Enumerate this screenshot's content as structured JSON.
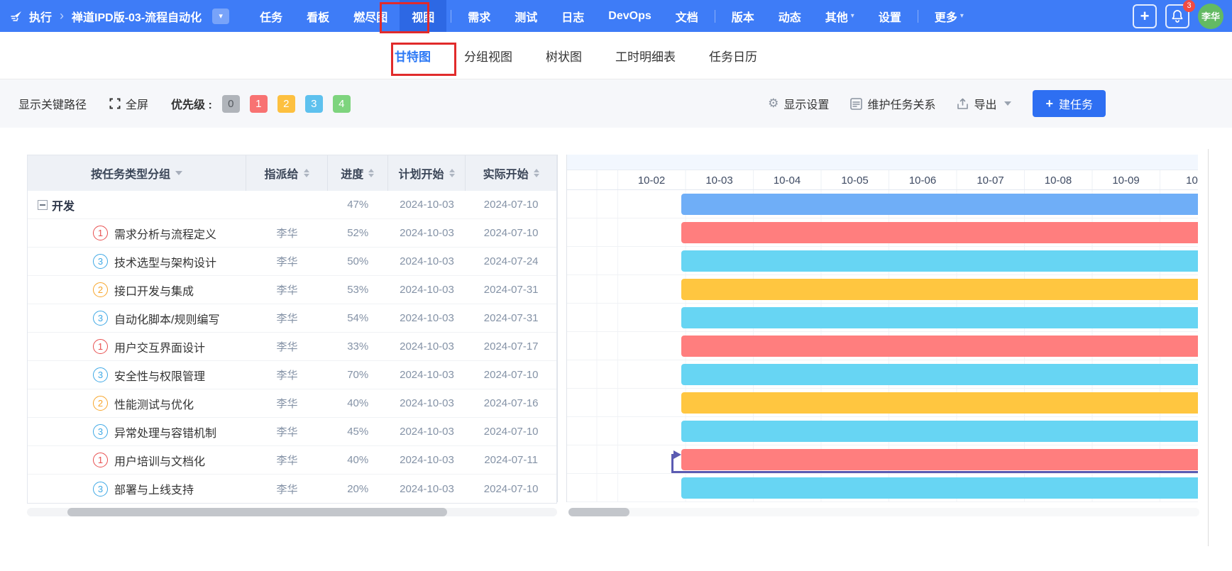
{
  "navbar": {
    "breadcrumb": {
      "section": "执行",
      "project": "禅道IPD版-03-流程自动化"
    },
    "items": [
      {
        "label": "任务"
      },
      {
        "label": "看板"
      },
      {
        "label": "燃尽图"
      },
      {
        "label": "视图",
        "active": true,
        "divider_after": true
      },
      {
        "label": "需求"
      },
      {
        "label": "测试"
      },
      {
        "label": "日志"
      },
      {
        "label": "DevOps"
      },
      {
        "label": "文档",
        "divider_after": true
      },
      {
        "label": "版本"
      },
      {
        "label": "动态"
      },
      {
        "label": "其他",
        "caret": true
      },
      {
        "label": "设置",
        "divider_after": true
      },
      {
        "label": "更多",
        "caret": true
      }
    ],
    "notification_count": "3",
    "avatar": "李华"
  },
  "tabs": [
    {
      "label": "甘特图",
      "active": true
    },
    {
      "label": "分组视图"
    },
    {
      "label": "树状图"
    },
    {
      "label": "工时明细表"
    },
    {
      "label": "任务日历"
    }
  ],
  "toolbar": {
    "show_critical_path": "显示关键路径",
    "fullscreen": "全屏",
    "priority_label": "优先级 :",
    "priorities": [
      {
        "label": "0",
        "bg": "#b0b4ba",
        "color": "#565a60"
      },
      {
        "label": "1",
        "bg": "#f87272",
        "color": "#ffffff"
      },
      {
        "label": "2",
        "bg": "#fdc040",
        "color": "#ffffff"
      },
      {
        "label": "3",
        "bg": "#5ec1ee",
        "color": "#ffffff"
      },
      {
        "label": "4",
        "bg": "#7ed47e",
        "color": "#ffffff"
      }
    ],
    "display_settings": "显示设置",
    "maintain_relations": "维护任务关系",
    "export": "导出",
    "create_task": "建任务"
  },
  "table": {
    "headers": {
      "group_by": "按任务类型分组",
      "assignee": "指派给",
      "progress": "进度",
      "planned_start": "计划开始",
      "actual_start": "实际开始"
    },
    "rows": [
      {
        "group": true,
        "name": "开发",
        "assignee": "",
        "progress": "47%",
        "planned_start": "2024-10-03",
        "actual_start": "2024-07-10",
        "bar_color": "#6faef7"
      },
      {
        "priority": "1",
        "priority_color": "#e84f4f",
        "name": "需求分析与流程定义",
        "assignee": "李华",
        "progress": "52%",
        "planned_start": "2024-10-03",
        "actual_start": "2024-07-10",
        "bar_color": "#ff7e7e"
      },
      {
        "priority": "3",
        "priority_color": "#3ea8e5",
        "name": "技术选型与架构设计",
        "assignee": "李华",
        "progress": "50%",
        "planned_start": "2024-10-03",
        "actual_start": "2024-07-24",
        "bar_color": "#67d5f3"
      },
      {
        "priority": "2",
        "priority_color": "#f7a52b",
        "name": "接口开发与集成",
        "assignee": "李华",
        "progress": "53%",
        "planned_start": "2024-10-03",
        "actual_start": "2024-07-31",
        "bar_color": "#ffc640"
      },
      {
        "priority": "3",
        "priority_color": "#3ea8e5",
        "name": "自动化脚本/规则编写",
        "assignee": "李华",
        "progress": "54%",
        "planned_start": "2024-10-03",
        "actual_start": "2024-07-31",
        "bar_color": "#67d5f3"
      },
      {
        "priority": "1",
        "priority_color": "#e84f4f",
        "name": "用户交互界面设计",
        "assignee": "李华",
        "progress": "33%",
        "planned_start": "2024-10-03",
        "actual_start": "2024-07-17",
        "bar_color": "#ff7e7e"
      },
      {
        "priority": "3",
        "priority_color": "#3ea8e5",
        "name": "安全性与权限管理",
        "assignee": "李华",
        "progress": "70%",
        "planned_start": "2024-10-03",
        "actual_start": "2024-07-10",
        "bar_color": "#67d5f3"
      },
      {
        "priority": "2",
        "priority_color": "#f7a52b",
        "name": "性能测试与优化",
        "assignee": "李华",
        "progress": "40%",
        "planned_start": "2024-10-03",
        "actual_start": "2024-07-16",
        "bar_color": "#ffc640"
      },
      {
        "priority": "3",
        "priority_color": "#3ea8e5",
        "name": "异常处理与容错机制",
        "assignee": "李华",
        "progress": "45%",
        "planned_start": "2024-10-03",
        "actual_start": "2024-07-10",
        "bar_color": "#67d5f3"
      },
      {
        "priority": "1",
        "priority_color": "#e84f4f",
        "name": "用户培训与文档化",
        "assignee": "李华",
        "progress": "40%",
        "planned_start": "2024-10-03",
        "actual_start": "2024-07-11",
        "bar_color": "#ff7e7e",
        "dependency": true
      },
      {
        "priority": "3",
        "priority_color": "#3ea8e5",
        "name": "部署与上线支持",
        "assignee": "李华",
        "progress": "20%",
        "planned_start": "2024-10-03",
        "actual_start": "2024-07-10",
        "bar_color": "#67d5f3"
      }
    ]
  },
  "gantt": {
    "dates": [
      "10-02",
      "10-03",
      "10-04",
      "10-05",
      "10-06",
      "10-07",
      "10-08",
      "10-09",
      "10-"
    ],
    "dependency_color": "#5b5bb2"
  },
  "icons": {
    "plus": "+",
    "gear": "⚙",
    "caret": "▾",
    "chevron": "›"
  },
  "colors": {
    "accent": "#2e7af5",
    "navbar": "#3e7cf7",
    "nav_active": "#2d68e4"
  }
}
